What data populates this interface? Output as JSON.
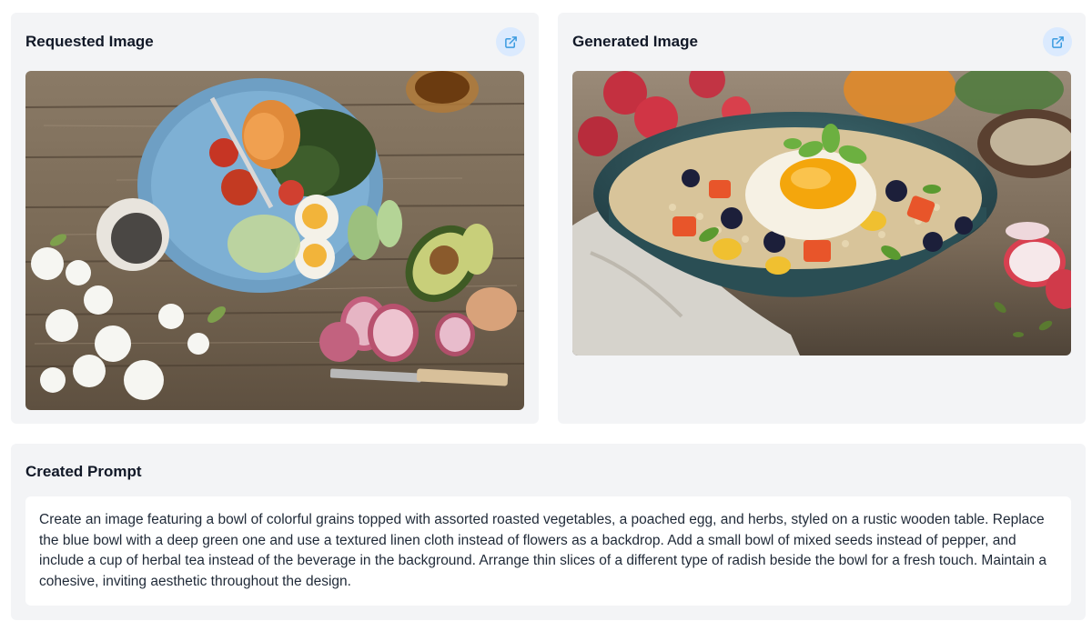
{
  "requested": {
    "title": "Requested Image",
    "open_icon": "external-link-icon",
    "image_description_icon": "photo"
  },
  "generated": {
    "title": "Generated Image",
    "open_icon": "external-link-icon"
  },
  "prompt": {
    "title": "Created Prompt",
    "text": "Create an image featuring a bowl of colorful grains topped with assorted roasted vegetables, a poached egg, and herbs, styled on a rustic wooden table. Replace the blue bowl with a deep green one and use a textured linen cloth instead of flowers as a backdrop. Add a small bowl of mixed seeds instead of pepper, and include a cup of herbal tea instead of the beverage in the background. Arrange thin slices of a different type of radish beside the bowl for a fresh touch. Maintain a cohesive, inviting aesthetic throughout the design."
  },
  "colors": {
    "card_bg": "#f3f4f6",
    "button_bg": "#dbeafe",
    "icon": "#3b9be0"
  }
}
